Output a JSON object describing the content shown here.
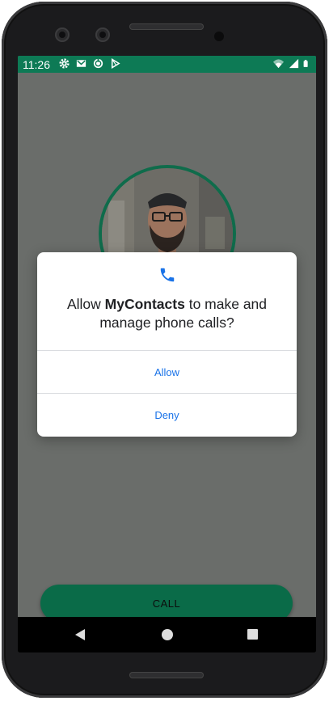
{
  "status_bar": {
    "time": "11:26",
    "left_icons": [
      "gear-icon",
      "gmail-icon",
      "sync-icon",
      "play-store-icon"
    ],
    "right_icons": [
      "wifi-icon",
      "signal-icon",
      "battery-icon"
    ],
    "color": "#0d7a55"
  },
  "profile": {
    "avatar": "profile-photo",
    "ring_color": "#0f6c4b"
  },
  "dialog": {
    "icon": "phone-icon",
    "title_prefix": "Allow ",
    "app_name": "MyContacts",
    "title_suffix": " to make and manage phone calls?",
    "allow_label": "Allow",
    "deny_label": "Deny",
    "accent": "#1a73e8"
  },
  "main": {
    "call_button_label": "CALL",
    "button_color": "#0a6b48"
  },
  "navbar": {
    "back": "back-icon",
    "home": "home-icon",
    "recents": "recents-icon"
  }
}
